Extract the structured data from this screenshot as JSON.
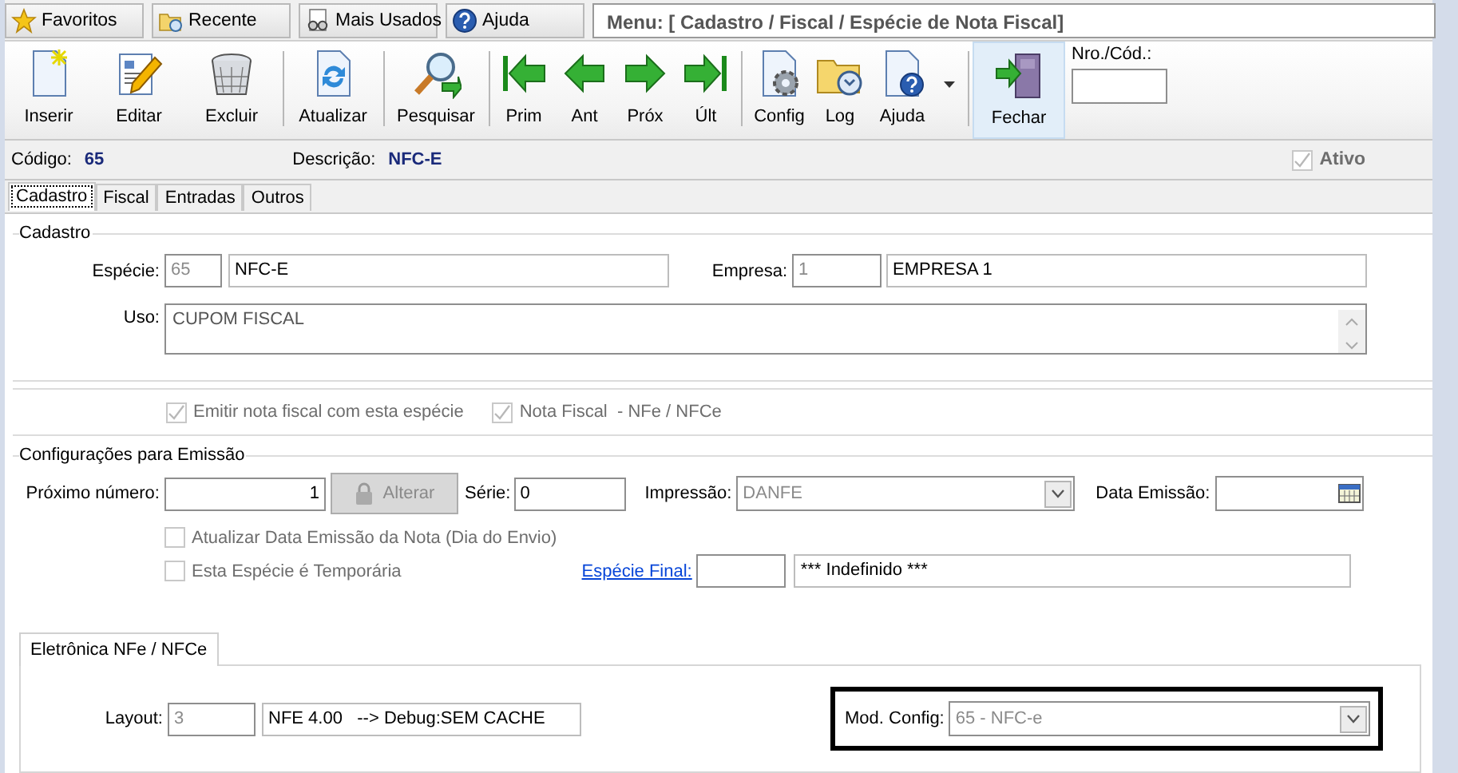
{
  "top_bar": {
    "buttons": [
      {
        "label": "Favoritos"
      },
      {
        "label": "Recente"
      },
      {
        "label": "Mais Usados"
      },
      {
        "label": "Ajuda"
      }
    ],
    "menu_path": "Menu: [ Cadastro / Fiscal / Espécie de Nota Fiscal]"
  },
  "toolbar": {
    "buttons": [
      {
        "label": "Inserir",
        "separator_after": false,
        "dropdown": false,
        "highlighted": false
      },
      {
        "label": "Editar",
        "separator_after": false,
        "dropdown": false,
        "highlighted": false
      },
      {
        "label": "Excluir",
        "separator_after": true,
        "dropdown": false,
        "highlighted": false
      },
      {
        "label": "Atualizar",
        "separator_after": true,
        "dropdown": false,
        "highlighted": false
      },
      {
        "label": "Pesquisar",
        "separator_after": true,
        "dropdown": false,
        "highlighted": false
      },
      {
        "label": "Prim",
        "separator_after": false,
        "dropdown": false,
        "highlighted": false
      },
      {
        "label": "Ant",
        "separator_after": false,
        "dropdown": false,
        "highlighted": false
      },
      {
        "label": "Próx",
        "separator_after": false,
        "dropdown": false,
        "highlighted": false
      },
      {
        "label": "Últ",
        "separator_after": true,
        "dropdown": false,
        "highlighted": false
      },
      {
        "label": "Config",
        "separator_after": false,
        "dropdown": false,
        "highlighted": false
      },
      {
        "label": "Log",
        "separator_after": false,
        "dropdown": false,
        "highlighted": false
      },
      {
        "label": "Ajuda",
        "separator_after": true,
        "dropdown": true,
        "highlighted": false
      },
      {
        "label": "Fechar",
        "separator_after": false,
        "dropdown": false,
        "highlighted": true
      }
    ],
    "code_field": {
      "label": "Nro./Cód.:"
    }
  },
  "info": {
    "codigo_label": "Código:",
    "codigo": "65",
    "descricao_label": "Descrição:",
    "descricao": "NFC-E",
    "ativo": {
      "label": "Ativo",
      "checked": true,
      "disabled": true
    }
  },
  "tabs": [
    {
      "label": "Cadastro",
      "selected": true
    },
    {
      "label": "Fiscal",
      "selected": false
    },
    {
      "label": "Entradas",
      "selected": false
    },
    {
      "label": "Outros",
      "selected": false
    }
  ],
  "cadastro": {
    "title": "Cadastro",
    "especie": {
      "label": "Espécie:",
      "code": {
        "value": "65",
        "disabled": true
      },
      "name": {
        "value": "NFC-E",
        "disabled": false
      }
    },
    "empresa": {
      "label": "Empresa:",
      "code": {
        "value": "1",
        "disabled": true
      },
      "name": {
        "value": "EMPRESA 1",
        "disabled": false
      }
    },
    "uso": {
      "label": "Uso:",
      "value": "CUPOM FISCAL",
      "disabled": true
    }
  },
  "flags": [
    {
      "label": "Emitir nota fiscal com esta espécie",
      "checked": true,
      "disabled": true
    },
    {
      "label": "Nota Fiscal  - NFe / NFCe",
      "checked": true,
      "disabled": true
    }
  ],
  "emissao": {
    "title": "Configurações para Emissão",
    "proximo": {
      "label": "Próximo número:",
      "value": "1",
      "disabled": false
    },
    "alterar": {
      "label": "Alterar",
      "disabled": true
    },
    "serie": {
      "label": "Série:",
      "value": "0",
      "disabled": false
    },
    "impressao": {
      "label": "Impressão:",
      "value": "DANFE",
      "disabled": true
    },
    "data_emissao": {
      "label": "Data Emissão:"
    },
    "options": [
      {
        "label": "Atualizar Data Emissão da Nota (Dia do Envio)",
        "checked": false,
        "disabled": true
      },
      {
        "label": "Esta Espécie é Temporária",
        "checked": false,
        "disabled": true
      }
    ],
    "especie_final": {
      "label": "Espécie Final:",
      "name": {
        "value": "*** Indefinido ***",
        "disabled": false
      }
    }
  },
  "sub_tabs": [
    {
      "label": "Eletrônica NFe / NFCe",
      "selected": true
    }
  ],
  "eletronica": {
    "layout": {
      "label": "Layout:",
      "code": {
        "value": "3",
        "disabled": true
      },
      "description": {
        "value": "NFE 4.00   --> Debug:SEM CACHE",
        "disabled": false
      }
    },
    "mod_config": {
      "label": "Mod. Config:",
      "value": "65 - NFC-e",
      "disabled": true,
      "highlighted": true
    }
  }
}
